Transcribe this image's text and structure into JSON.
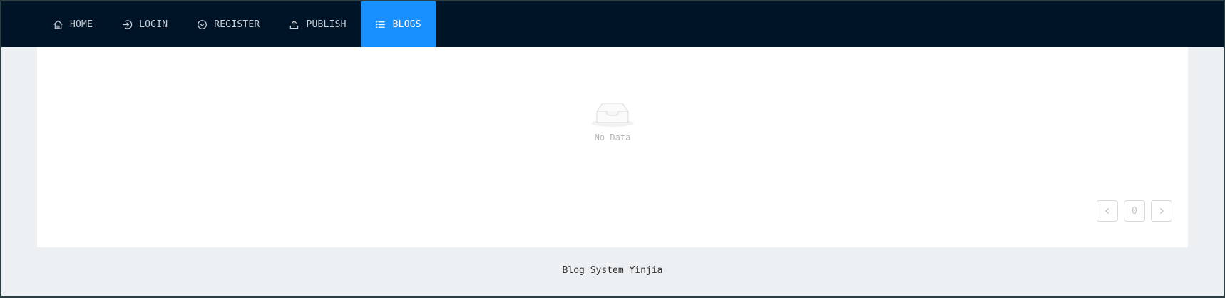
{
  "nav": {
    "items": [
      {
        "label": "HOME",
        "icon": "home-icon"
      },
      {
        "label": "LOGIN",
        "icon": "login-icon"
      },
      {
        "label": "REGISTER",
        "icon": "register-icon"
      },
      {
        "label": "PUBLISH",
        "icon": "upload-icon"
      },
      {
        "label": "BLOGS",
        "icon": "list-icon",
        "active": true
      }
    ]
  },
  "main": {
    "empty_text": "No Data"
  },
  "pagination": {
    "current_page": "0",
    "prev_icon": "chevron-left-icon",
    "next_icon": "chevron-right-icon"
  },
  "footer": {
    "text": "Blog System Yinjia"
  },
  "colors": {
    "navbar_bg": "#001428",
    "active_tab": "#1890ff",
    "page_bg": "#ecf0f3"
  }
}
